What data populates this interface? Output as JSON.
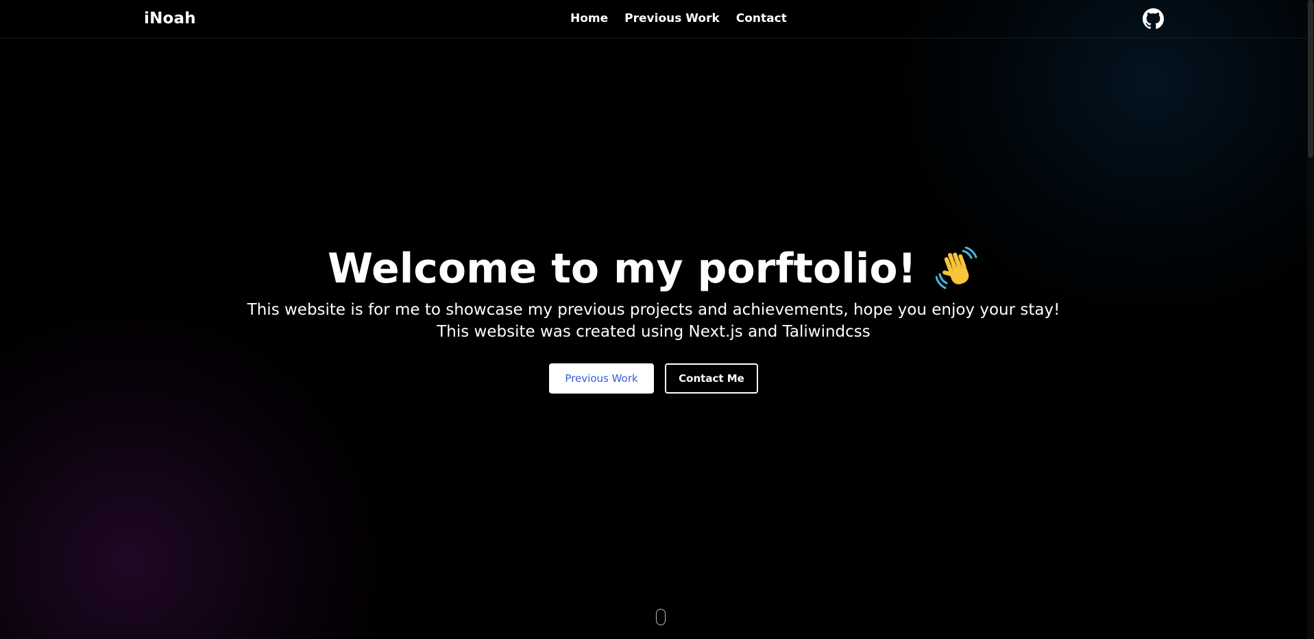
{
  "navbar": {
    "brand": "iNoah",
    "links": [
      {
        "label": "Home"
      },
      {
        "label": "Previous Work"
      },
      {
        "label": "Contact"
      }
    ],
    "github_icon": "github-icon"
  },
  "hero": {
    "title": "Welcome to my porftolio!",
    "title_icon": "waving-hand-icon",
    "subtitle_line1": "This website is for me to showcase my previous projects and achievements, hope you enjoy your stay!",
    "subtitle_line2": "This website was created using Next.js and Taliwindcss",
    "buttons": {
      "primary_label": "Previous Work",
      "secondary_label": "Contact Me"
    }
  },
  "colors": {
    "background": "#000000",
    "primary_button_text": "#3b5bd6",
    "text": "#ffffff"
  }
}
